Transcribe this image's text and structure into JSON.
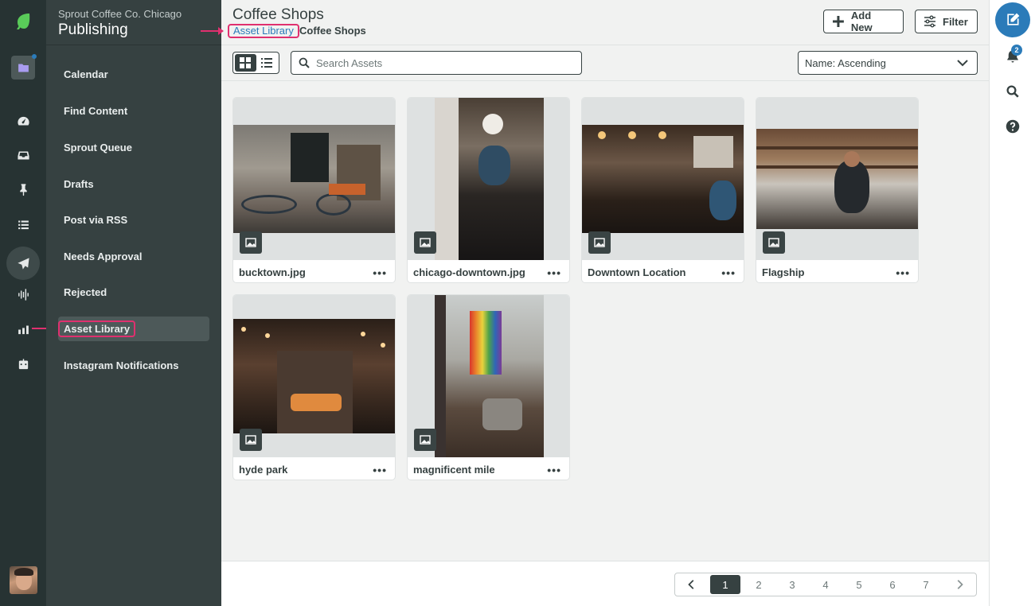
{
  "nav": {
    "brand": "Sprout Coffee Co. Chicago",
    "section": "Publishing",
    "items": [
      {
        "label": "Calendar"
      },
      {
        "label": "Find Content"
      },
      {
        "label": "Sprout Queue"
      },
      {
        "label": "Drafts"
      },
      {
        "label": "Post via RSS"
      },
      {
        "label": "Needs Approval"
      },
      {
        "label": "Rejected"
      },
      {
        "label": "Asset Library",
        "active": true
      },
      {
        "label": "Instagram Notifications"
      }
    ]
  },
  "header": {
    "title": "Coffee Shops",
    "breadcrumb_link": "Asset Library",
    "breadcrumb_current": "Coffee Shops",
    "add_new_label": "Add New",
    "filter_label": "Filter"
  },
  "toolbar": {
    "search_placeholder": "Search Assets",
    "sort_value": "Name: Ascending"
  },
  "assets": [
    {
      "name": "bucktown.jpg",
      "more": "•••"
    },
    {
      "name": "chicago-downtown.jpg",
      "more": "•••"
    },
    {
      "name": "Downtown Location",
      "more": "•••"
    },
    {
      "name": "Flagship",
      "more": "•••"
    },
    {
      "name": "hyde park",
      "more": "•••"
    },
    {
      "name": "magnificent mile",
      "more": "•••"
    }
  ],
  "pagination": {
    "pages": [
      "1",
      "2",
      "3",
      "4",
      "5",
      "6",
      "7"
    ],
    "current": "1"
  },
  "right_rail": {
    "notification_count": "2"
  },
  "colors": {
    "accent": "#2b7bb9",
    "highlight": "#e0306f",
    "brand_green": "#59cb59",
    "nav_bg": "#364141"
  }
}
